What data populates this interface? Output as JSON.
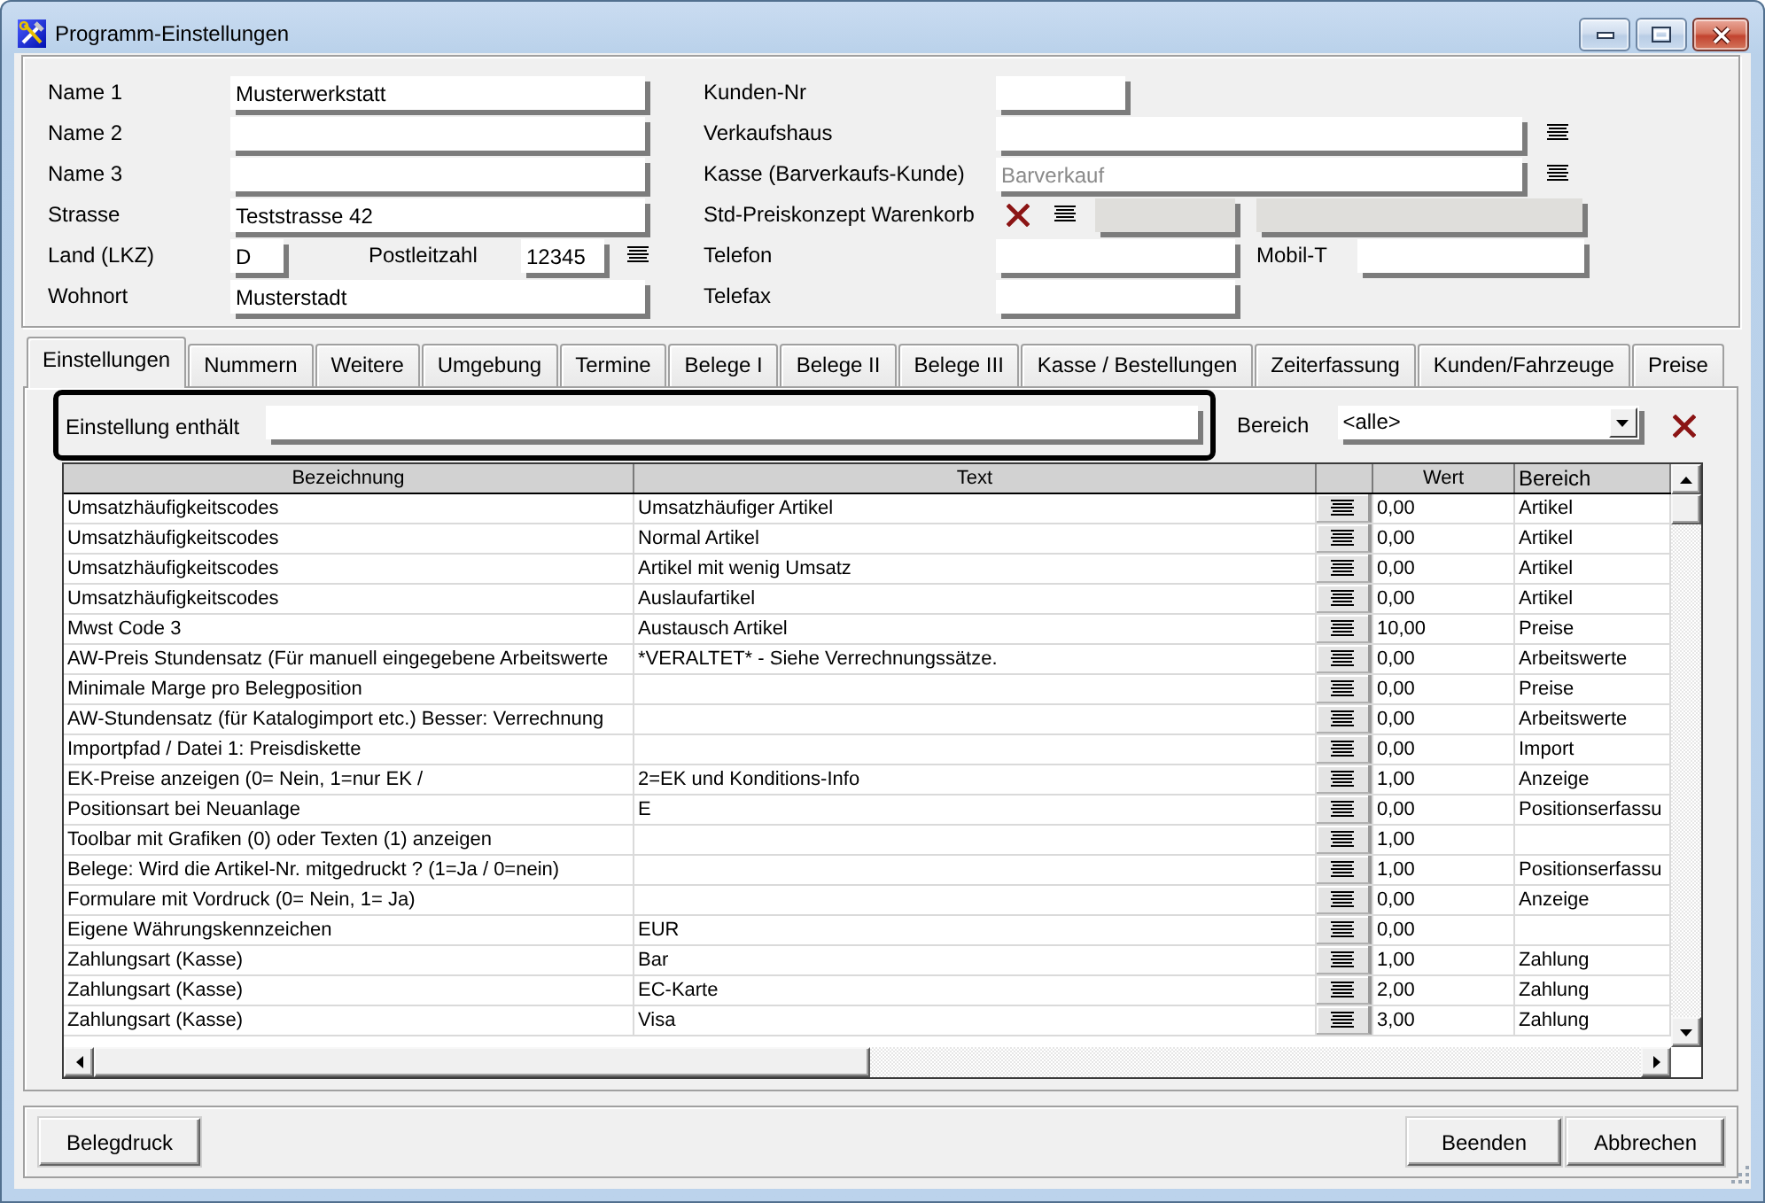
{
  "window": {
    "title": "Programm-Einstellungen"
  },
  "customer_form": {
    "left_rows": [
      {
        "label": "Name 1",
        "items": [
          {
            "kind": "field",
            "value": "Musterwerkstatt"
          }
        ]
      },
      {
        "label": "Name 2",
        "items": [
          {
            "kind": "field"
          }
        ]
      },
      {
        "label": "Name 3",
        "items": [
          {
            "kind": "field"
          }
        ]
      },
      {
        "label": "Strasse",
        "items": [
          {
            "kind": "field",
            "value": "Teststrasse 42"
          }
        ]
      },
      {
        "label": "Land (LKZ)",
        "items": [
          {
            "kind": "field",
            "value": "D"
          },
          {
            "kind": "label",
            "text": "Postleitzahl"
          },
          {
            "kind": "field",
            "value": "12345"
          },
          {
            "kind": "list_button"
          }
        ]
      },
      {
        "label": "Wohnort",
        "items": [
          {
            "kind": "field",
            "value": "Musterstadt"
          }
        ]
      }
    ],
    "right_rows": [
      {
        "label": "Kunden-Nr",
        "items": [
          {
            "kind": "field"
          }
        ]
      },
      {
        "label": "Verkaufshaus",
        "items": [
          {
            "kind": "field"
          },
          {
            "kind": "list_button"
          }
        ]
      },
      {
        "label": "Kasse (Barverkaufs-Kunde)",
        "items": [
          {
            "kind": "field",
            "placeholder": "Barverkauf"
          },
          {
            "kind": "list_button"
          }
        ]
      },
      {
        "label": "Std-Preiskonzept Warenkorb",
        "items": [
          {
            "kind": "clear_button"
          },
          {
            "kind": "list_button"
          },
          {
            "kind": "field",
            "disabled": true
          },
          {
            "kind": "field",
            "disabled": true
          }
        ]
      },
      {
        "label": "Telefon",
        "items": [
          {
            "kind": "field"
          },
          {
            "kind": "label",
            "text": "Mobil-T"
          },
          {
            "kind": "field"
          }
        ]
      },
      {
        "label": "Telefax",
        "items": [
          {
            "kind": "field"
          }
        ]
      }
    ]
  },
  "tabs": [
    {
      "label": "Einstellungen",
      "selected": true
    },
    {
      "label": "Nummern",
      "selected": false
    },
    {
      "label": "Weitere",
      "selected": false
    },
    {
      "label": "Umgebung",
      "selected": false
    },
    {
      "label": "Termine",
      "selected": false
    },
    {
      "label": "Belege I",
      "selected": false
    },
    {
      "label": "Belege II",
      "selected": false
    },
    {
      "label": "Belege III",
      "selected": false
    },
    {
      "label": "Kasse / Bestellungen",
      "selected": false
    },
    {
      "label": "Zeiterfassung",
      "selected": false
    },
    {
      "label": "Kunden/Fahrzeuge",
      "selected": false
    },
    {
      "label": "Preise",
      "selected": false
    }
  ],
  "filter": {
    "label": "Einstellung enthält",
    "area_label": "Bereich",
    "area_value": "<alle>"
  },
  "settings_table": {
    "columns": [
      "Bezeichnung",
      "Text",
      "Wert",
      "Bereich"
    ],
    "rows": [
      {
        "bezeichnung": "Umsatzhäufigkeitscodes",
        "text": "Umsatzhäufiger Artikel",
        "wert": "0,00",
        "bereich": "Artikel"
      },
      {
        "bezeichnung": "Umsatzhäufigkeitscodes",
        "text": "Normal Artikel",
        "wert": "0,00",
        "bereich": "Artikel"
      },
      {
        "bezeichnung": "Umsatzhäufigkeitscodes",
        "text": "Artikel mit wenig Umsatz",
        "wert": "0,00",
        "bereich": "Artikel"
      },
      {
        "bezeichnung": "Umsatzhäufigkeitscodes",
        "text": "Auslaufartikel",
        "wert": "0,00",
        "bereich": "Artikel"
      },
      {
        "bezeichnung": "Mwst Code 3",
        "text": "Austausch Artikel",
        "wert": "10,00",
        "bereich": "Preise"
      },
      {
        "bezeichnung": "AW-Preis Stundensatz (Für manuell eingegebene Arbeitswerte",
        "text": "*VERALTET* - Siehe Verrechnungssätze.",
        "wert": "0,00",
        "bereich": "Arbeitswerte"
      },
      {
        "bezeichnung": "Minimale Marge pro Belegposition",
        "wert": "0,00",
        "bereich": "Preise"
      },
      {
        "bezeichnung": "AW-Stundensatz (für Katalogimport etc.) Besser: Verrechnung",
        "wert": "0,00",
        "bereich": "Arbeitswerte"
      },
      {
        "bezeichnung": "Importpfad / Datei 1: Preisdiskette",
        "wert": "0,00",
        "bereich": "Import"
      },
      {
        "bezeichnung": "EK-Preise anzeigen (0= Nein, 1=nur EK /",
        "text": "2=EK und Konditions-Info",
        "wert": "1,00",
        "bereich": "Anzeige"
      },
      {
        "bezeichnung": "Positionsart bei Neuanlage",
        "text": "E",
        "wert": "0,00",
        "bereich": "Positionserfassu"
      },
      {
        "bezeichnung": "Toolbar mit Grafiken (0) oder Texten (1) anzeigen",
        "wert": "1,00"
      },
      {
        "bezeichnung": "Belege: Wird die Artikel-Nr. mitgedruckt ? (1=Ja / 0=nein)",
        "wert": "1,00",
        "bereich": "Positionserfassu"
      },
      {
        "bezeichnung": "Formulare mit Vordruck (0= Nein, 1= Ja)",
        "wert": "0,00",
        "bereich": "Anzeige"
      },
      {
        "bezeichnung": "Eigene Währungskennzeichen",
        "text": "EUR",
        "wert": "0,00"
      },
      {
        "bezeichnung": "Zahlungsart (Kasse)",
        "text": "Bar",
        "wert": "1,00",
        "bereich": "Zahlung"
      },
      {
        "bezeichnung": "Zahlungsart (Kasse)",
        "text": "EC-Karte",
        "wert": "2,00",
        "bereich": "Zahlung"
      },
      {
        "bezeichnung": "Zahlungsart (Kasse)",
        "text": "Visa",
        "wert": "3,00",
        "bereich": "Zahlung"
      }
    ]
  },
  "buttons": {
    "left": [
      "Belegdruck"
    ],
    "right": [
      "Beenden",
      "Abbrechen"
    ]
  }
}
